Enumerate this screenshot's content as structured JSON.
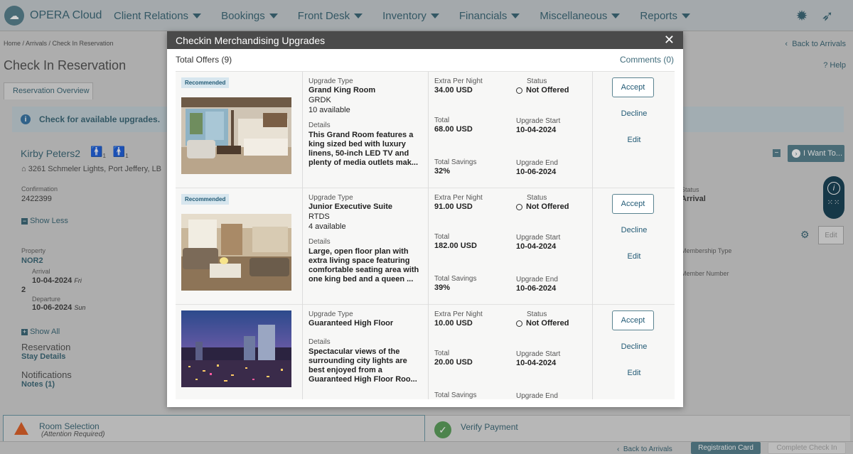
{
  "app": {
    "title": "OPERA Cloud"
  },
  "nav": [
    "Client Relations",
    "Bookings",
    "Front Desk",
    "Inventory",
    "Financials",
    "Miscellaneous",
    "Reports"
  ],
  "breadcrumb": "Home / Arrivals / Check In Reservation",
  "back_to_arrivals": "Back to Arrivals",
  "page_title": "Check In Reservation",
  "help": "Help",
  "tab": "Reservation Overview",
  "banner": "Check for available upgrades.",
  "guest": {
    "name": "Kirby Peters2",
    "adults": "1",
    "children": "1",
    "address": "3261 Schmeler Lights, Port Jeffery, LB"
  },
  "confirmation": {
    "label": "Confirmation",
    "value": "2422399"
  },
  "show_less": "Show Less",
  "property": {
    "label": "Property",
    "value": "NOR2"
  },
  "arrival": {
    "label": "Arrival",
    "date": "10-04-2024",
    "day": "Fri"
  },
  "nights": "2",
  "departure": {
    "label": "Departure",
    "date": "10-06-2024",
    "day": "Sun"
  },
  "show_all": "Show All",
  "reservation": {
    "label": "Reservation",
    "link": "Stay Details"
  },
  "notifications": {
    "label": "Notifications",
    "link": "Notes (1)"
  },
  "right_panel": {
    "i_want_to": "I Want To...",
    "status_label": "Status",
    "status_value": "Arrival",
    "membership_type": "Membership Type",
    "member_number": "Member Number",
    "edit": "Edit"
  },
  "steps": {
    "room_selection": {
      "title": "Room Selection",
      "sub": "(Attention Required)"
    },
    "verify_payment": {
      "title": "Verify Payment"
    }
  },
  "footer": {
    "back": "Back to Arrivals",
    "registration_card": "Registration Card",
    "complete_check_in": "Complete Check In"
  },
  "modal": {
    "title": "Checkin Merchandising Upgrades",
    "total_offers": "Total Offers (9)",
    "comments": "Comments (0)",
    "labels": {
      "upgrade_type": "Upgrade Type",
      "details": "Details",
      "extra_per_night": "Extra Per Night",
      "total": "Total",
      "total_savings": "Total Savings",
      "status": "Status",
      "upgrade_start": "Upgrade Start",
      "upgrade_end": "Upgrade End",
      "accept": "Accept",
      "decline": "Decline",
      "edit": "Edit"
    },
    "offers": [
      {
        "badge": "Recommended",
        "room": "Grand King Room",
        "code": "GRDK",
        "available": "10 available",
        "details": "This Grand Room features a king sized bed with luxury linens, 50-inch LED TV and plenty of media outlets mak...",
        "extra": "34.00 USD",
        "total": "68.00 USD",
        "savings": "32%",
        "status": "Not Offered",
        "start": "10-04-2024",
        "end": "10-06-2024"
      },
      {
        "badge": "Recommended",
        "room": "Junior Executive Suite",
        "code": "RTDS",
        "available": "4 available",
        "details": "Large, open floor plan with extra living space featuring comfortable seating area with one king bed and a queen ...",
        "extra": "91.00 USD",
        "total": "182.00 USD",
        "savings": "39%",
        "status": "Not Offered",
        "start": "10-04-2024",
        "end": "10-06-2024"
      },
      {
        "badge": "",
        "room": "Guaranteed High Floor",
        "code": "",
        "available": "",
        "details": "Spectacular views of the surrounding city lights are best enjoyed from a Guaranteed High Floor Roo...",
        "extra": "10.00 USD",
        "total": "20.00 USD",
        "savings": "",
        "status": "Not Offered",
        "start": "10-04-2024",
        "end": ""
      }
    ]
  }
}
